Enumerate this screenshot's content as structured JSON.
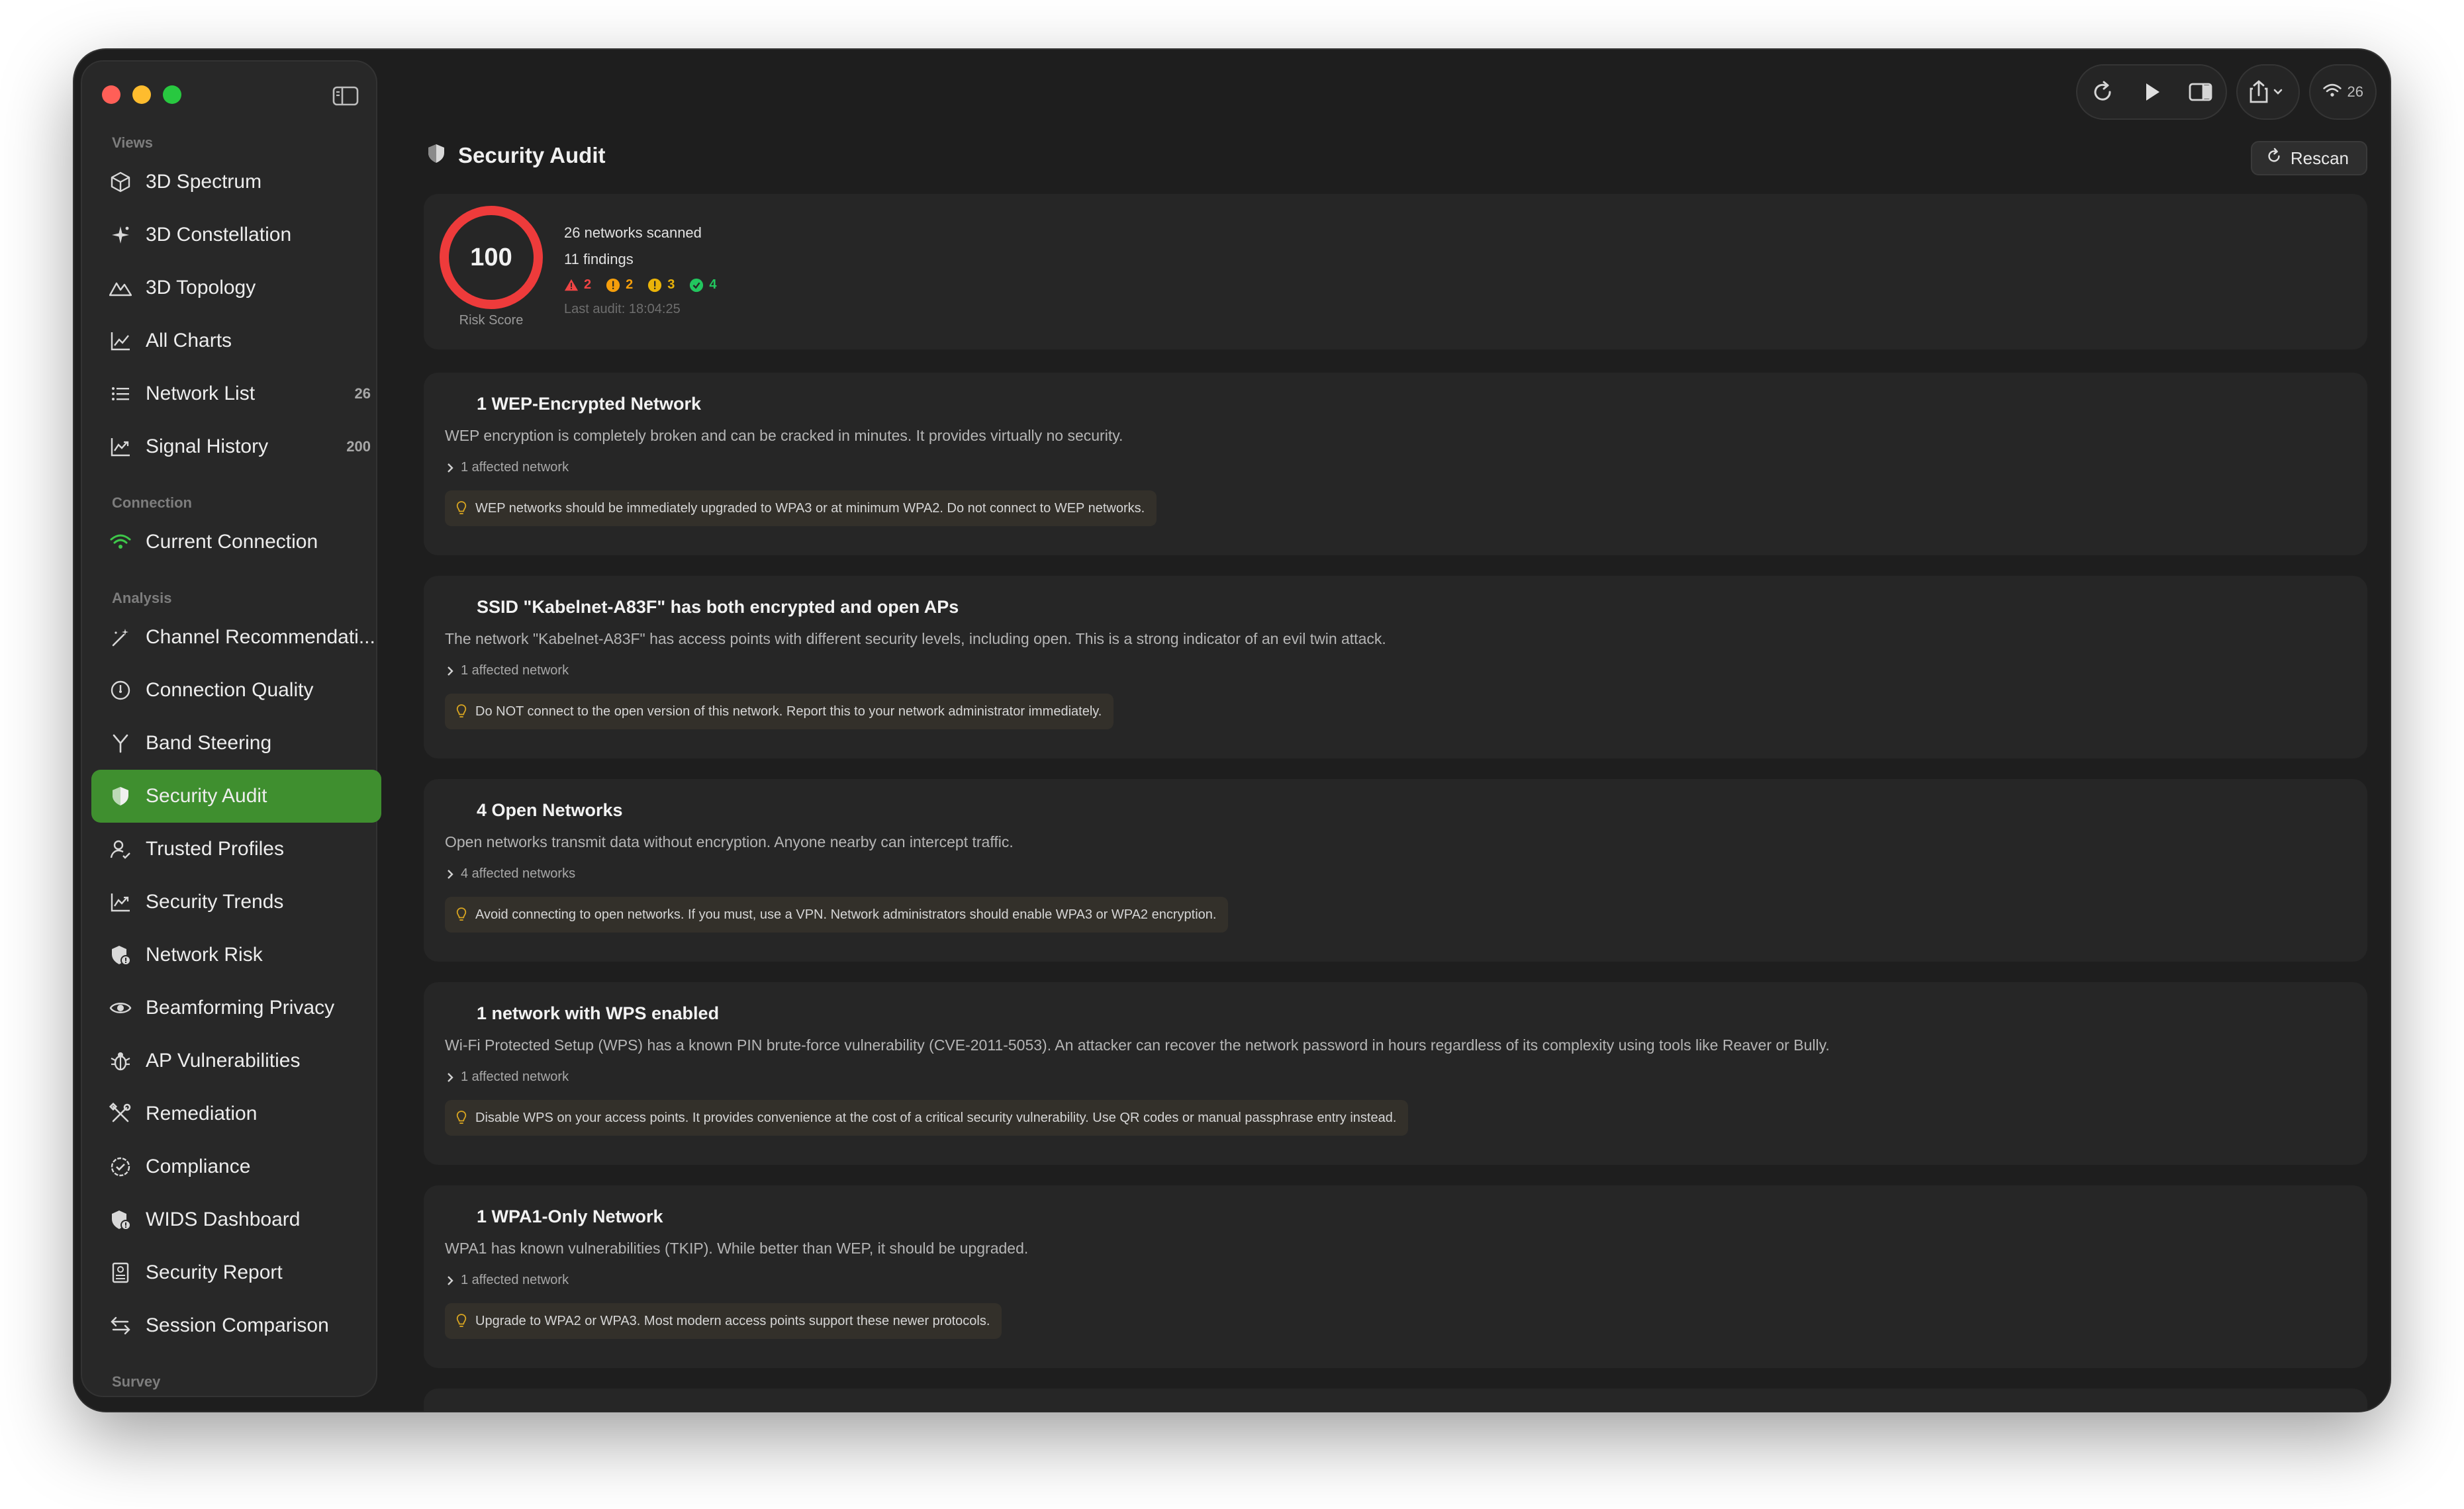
{
  "sidebar": {
    "sections": {
      "views": "Views",
      "connection": "Connection",
      "analysis": "Analysis",
      "survey": "Survey"
    },
    "items": [
      {
        "label": "3D Spectrum",
        "icon": "cube-icon"
      },
      {
        "label": "3D Constellation",
        "icon": "sparkles-icon"
      },
      {
        "label": "3D Topology",
        "icon": "mountains-icon"
      },
      {
        "label": "All Charts",
        "icon": "line-chart-icon"
      },
      {
        "label": "Network List",
        "icon": "list-icon",
        "count": "26"
      },
      {
        "label": "Signal History",
        "icon": "trend-chart-icon",
        "count": "200"
      },
      {
        "label": "Current Connection",
        "icon": "wifi-icon"
      },
      {
        "label": "Channel Recommendati...",
        "icon": "magic-wand-icon"
      },
      {
        "label": "Connection Quality",
        "icon": "gauge-icon"
      },
      {
        "label": "Band Steering",
        "icon": "fork-icon"
      },
      {
        "label": "Security Audit",
        "icon": "shield-icon"
      },
      {
        "label": "Trusted Profiles",
        "icon": "person-check-icon"
      },
      {
        "label": "Security Trends",
        "icon": "trend-chart-icon"
      },
      {
        "label": "Network Risk",
        "icon": "shield-alert-icon"
      },
      {
        "label": "Beamforming Privacy",
        "icon": "eye-icon"
      },
      {
        "label": "AP Vulnerabilities",
        "icon": "bug-icon"
      },
      {
        "label": "Remediation",
        "icon": "tools-icon"
      },
      {
        "label": "Compliance",
        "icon": "checkmark-seal-icon"
      },
      {
        "label": "WIDS Dashboard",
        "icon": "shield-alert-icon"
      },
      {
        "label": "Security Report",
        "icon": "report-icon"
      },
      {
        "label": "Session Comparison",
        "icon": "compare-arrows-icon"
      }
    ]
  },
  "toolbar": {
    "wifi_count": "26"
  },
  "main": {
    "title": "Security Audit",
    "rescan_label": "Rescan",
    "summary": {
      "score": "100",
      "score_label": "Risk Score",
      "networks_scanned": "26 networks scanned",
      "findings": "11 findings",
      "critical": "2",
      "high": "2",
      "medium": "3",
      "ok": "4",
      "last_audit": "Last audit: 18:04:25"
    },
    "findings": [
      {
        "title": "1 WEP-Encrypted Network",
        "description": "WEP encryption is completely broken and can be cracked in minutes. It provides virtually no security.",
        "affected": "1 affected network",
        "recommendation": "WEP networks should be immediately upgraded to WPA3 or at minimum WPA2. Do not connect to WEP networks."
      },
      {
        "title": "SSID \"Kabelnet-A83F\" has both encrypted and open APs",
        "description": "The network \"Kabelnet-A83F\" has access points with different security levels, including open. This is a strong indicator of an evil twin attack.",
        "affected": "1 affected network",
        "recommendation": "Do NOT connect to the open version of this network. Report this to your network administrator immediately."
      },
      {
        "title": "4 Open Networks",
        "description": "Open networks transmit data without encryption. Anyone nearby can intercept traffic.",
        "affected": "4 affected networks",
        "recommendation": "Avoid connecting to open networks. If you must, use a VPN. Network administrators should enable WPA3 or WPA2 encryption."
      },
      {
        "title": "1 network with WPS enabled",
        "description": "Wi-Fi Protected Setup (WPS) has a known PIN brute-force vulnerability (CVE-2011-5053). An attacker can recover the network password in hours regardless of its complexity using tools like Reaver or Bully.",
        "affected": "1 affected network",
        "recommendation": "Disable WPS on your access points. It provides convenience at the cost of a critical security vulnerability. Use QR codes or manual passphrase entry instead."
      },
      {
        "title": "1 WPA1-Only Network",
        "description": "WPA1 has known vulnerabilities (TKIP). While better than WEP, it should be upgraded.",
        "affected": "1 affected network",
        "recommendation": "Upgrade to WPA2 or WPA3. Most modern access points support these newer protocols."
      }
    ]
  },
  "colors": {
    "accent_green": "#3f8f2f",
    "score_red": "#ee3b3b",
    "critical": "#ef4444",
    "high": "#f59e0b",
    "medium": "#eab308",
    "ok": "#22c55e",
    "bulb": "#d9a520"
  }
}
